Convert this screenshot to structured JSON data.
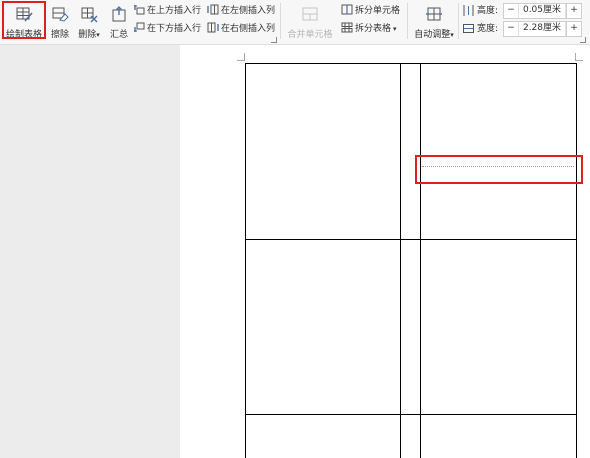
{
  "toolbar": {
    "draw_table": "绘制表格",
    "erase": "擦除",
    "delete": "删除",
    "summary": "汇总",
    "insert_row_above": "在上方插入行",
    "insert_row_below": "在下方插入行",
    "insert_col_left": "在左侧插入列",
    "insert_col_right": "在右侧插入列",
    "merge_cells": "合并单元格",
    "split_cells": "拆分单元格",
    "split_table": "拆分表格",
    "auto_fit": "自动调整",
    "height_label": "高度:",
    "height_value": "0.05厘米",
    "width_label": "宽度:",
    "width_value": "2.28厘米",
    "minus": "−",
    "plus": "+",
    "dropdown_caret": "▾"
  },
  "colors": {
    "highlight": "#e02020",
    "ribbon_bg": "#f7f7f7",
    "icon_blue": "#4a6fa5"
  }
}
